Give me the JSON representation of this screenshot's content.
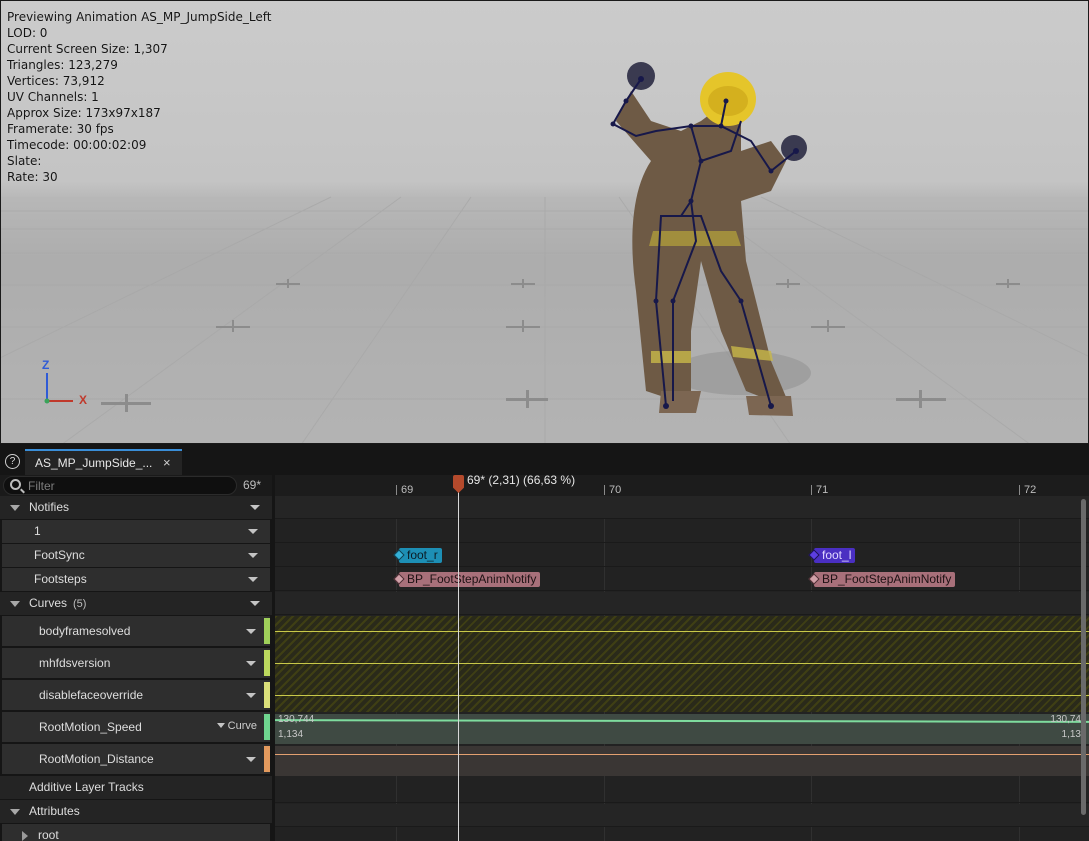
{
  "viewport": {
    "info_lines": [
      "Previewing Animation AS_MP_JumpSide_Left",
      "LOD: 0",
      "Current Screen Size: 1,307",
      "Triangles: 123,279",
      "Vertices: 73,912",
      "UV Channels: 1",
      "Approx Size: 173x97x187",
      "Framerate: 30 fps",
      "Timecode: 00:00:02:09",
      "Slate:",
      "Rate: 30"
    ],
    "axis_z": "Z",
    "axis_x": "X"
  },
  "tabs": {
    "help_label": "?",
    "active_tab_label": "AS_MP_JumpSide_...",
    "close_label": "×"
  },
  "filter": {
    "placeholder": "Filter",
    "current_frame": "69*"
  },
  "tracks": {
    "notifies_header": "Notifies",
    "notify_track_1": "1",
    "notify_track_footsync": "FootSync",
    "notify_track_footsteps": "Footsteps",
    "curves_header": "Curves",
    "curves_count": "(5)",
    "curves": [
      {
        "name": "bodyframesolved",
        "color": "#9fd05a"
      },
      {
        "name": "mhfdsversion",
        "color": "#bcd95e"
      },
      {
        "name": "disablefaceoverride",
        "color": "#dbe07a"
      },
      {
        "name": "RootMotion_Speed",
        "color": "#6fd58f",
        "button": "Curve"
      },
      {
        "name": "RootMotion_Distance",
        "color": "#e39a5e"
      }
    ],
    "additive_header": "Additive Layer Tracks",
    "attributes_header": "Attributes",
    "attr_root": "root"
  },
  "timeline": {
    "frames": [
      "69",
      "70",
      "71",
      "72"
    ],
    "playhead_label": "69* (2,31) (66,63 %)",
    "notifies": {
      "foot_r": "foot_r",
      "foot_l": "foot_l",
      "footstep_1": "BP_FootStepAnimNotify",
      "footstep_2": "BP_FootStepAnimNotify"
    },
    "speed_values": {
      "left_top": "130,744",
      "left_bottom": "1,134",
      "right_top": "130,74",
      "right_bottom": "1,13"
    }
  },
  "colors": {
    "accent": "#3a8ed8",
    "playhead": "#b44a2c",
    "notify_cyan": "#1d8fb5",
    "notify_purple": "#4a2fc2",
    "notify_pink": "#a8707a"
  }
}
